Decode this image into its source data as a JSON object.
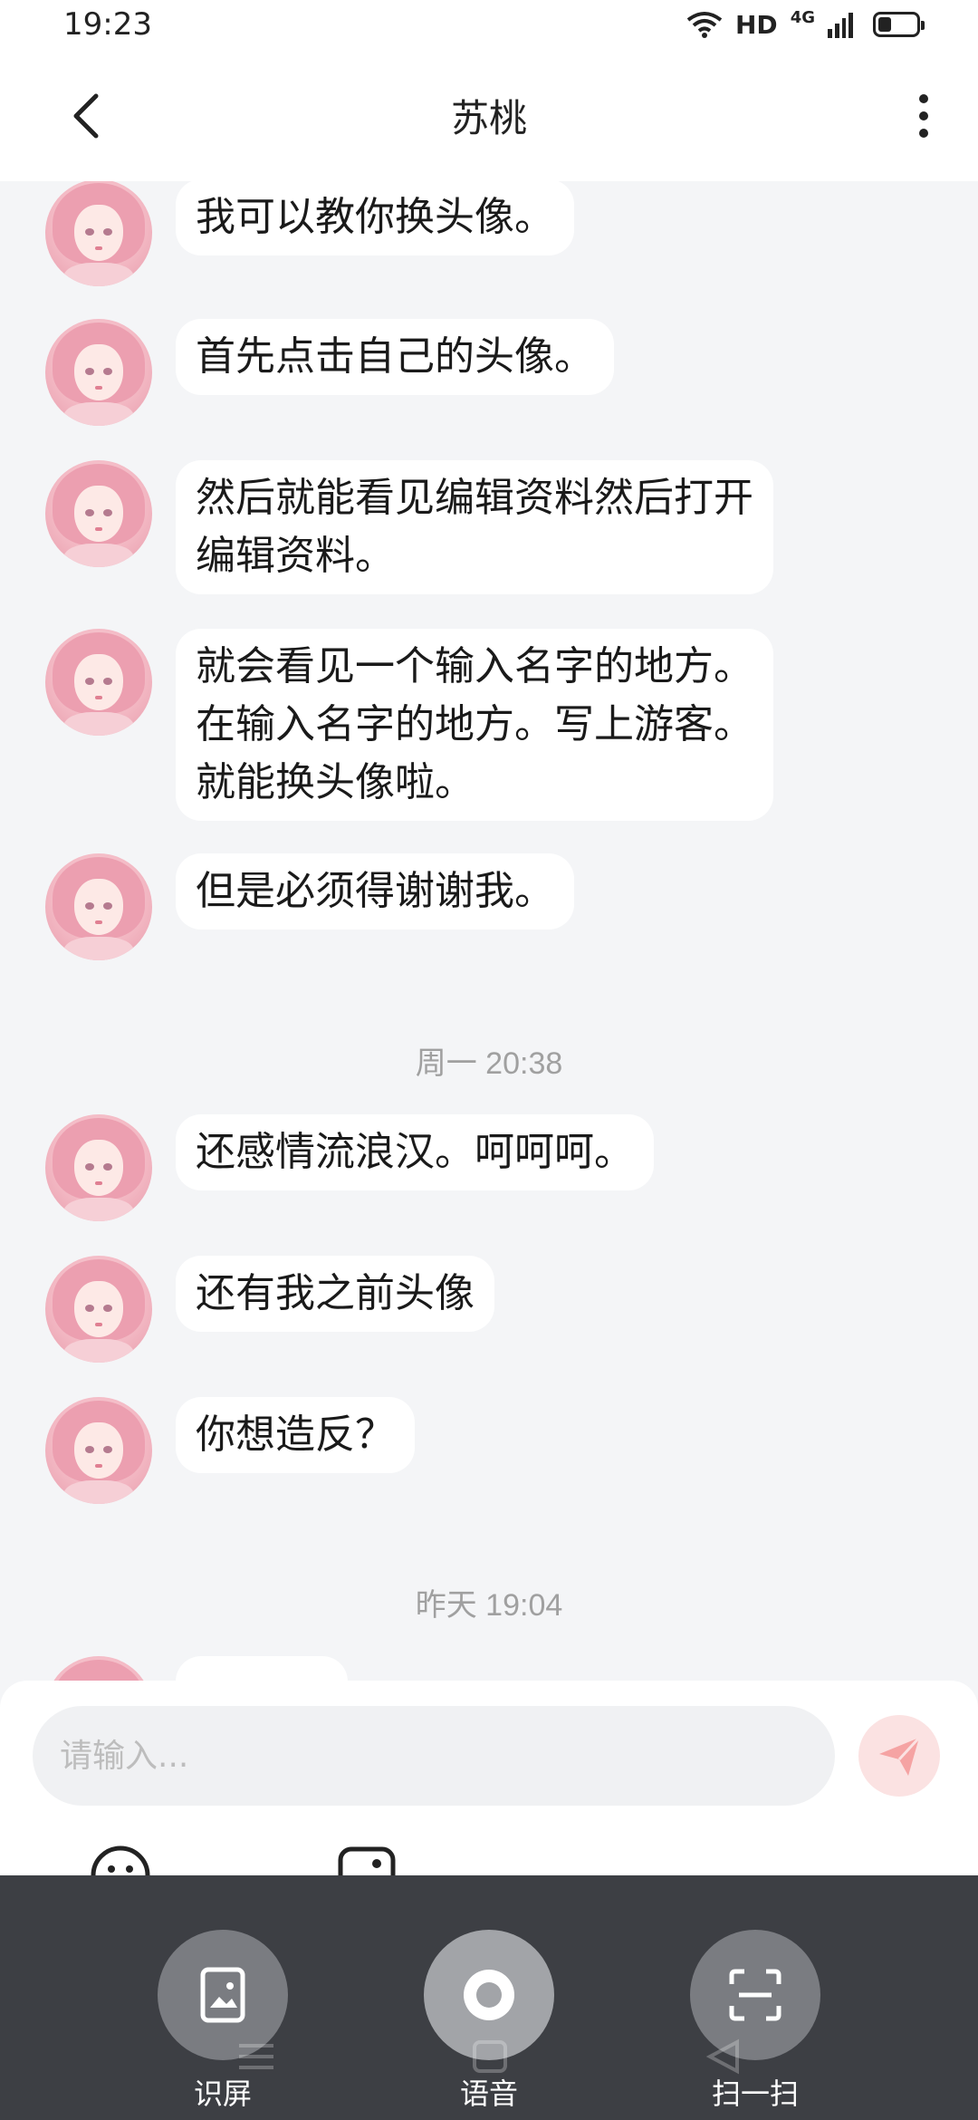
{
  "status_bar": {
    "time": "19:23",
    "hd": "HD",
    "network": "4G"
  },
  "header": {
    "title": "苏桃"
  },
  "messages": [
    {
      "text": "我可以教你换头像。"
    },
    {
      "text": "首先点击自己的头像。"
    },
    {
      "text": "然后就能看见编辑资料然后打开\n编辑资料。"
    },
    {
      "text": "就会看见一个输入名字的地方。\n在输入名字的地方。写上游客。\n就能换头像啦。"
    },
    {
      "text": "但是必须得谢谢我。"
    },
    {
      "text": "还感情流浪汉。呵呵呵。"
    },
    {
      "text": "还有我之前头像"
    },
    {
      "text": "你想造反？"
    }
  ],
  "timestamps": [
    "周一 20:38",
    "昨天 19:04"
  ],
  "input": {
    "placeholder": "请输入..."
  },
  "overlay_actions": [
    {
      "label": "识屏",
      "icon": "screen-recognize-icon"
    },
    {
      "label": "语音",
      "icon": "voice-icon"
    },
    {
      "label": "扫一扫",
      "icon": "scan-icon"
    }
  ],
  "colors": {
    "background": "#f4f5f7",
    "bubble": "#ffffff",
    "send_button": "#fbe2e2",
    "send_arrow": "#f5a3a3",
    "overlay": "#3d3f44"
  }
}
